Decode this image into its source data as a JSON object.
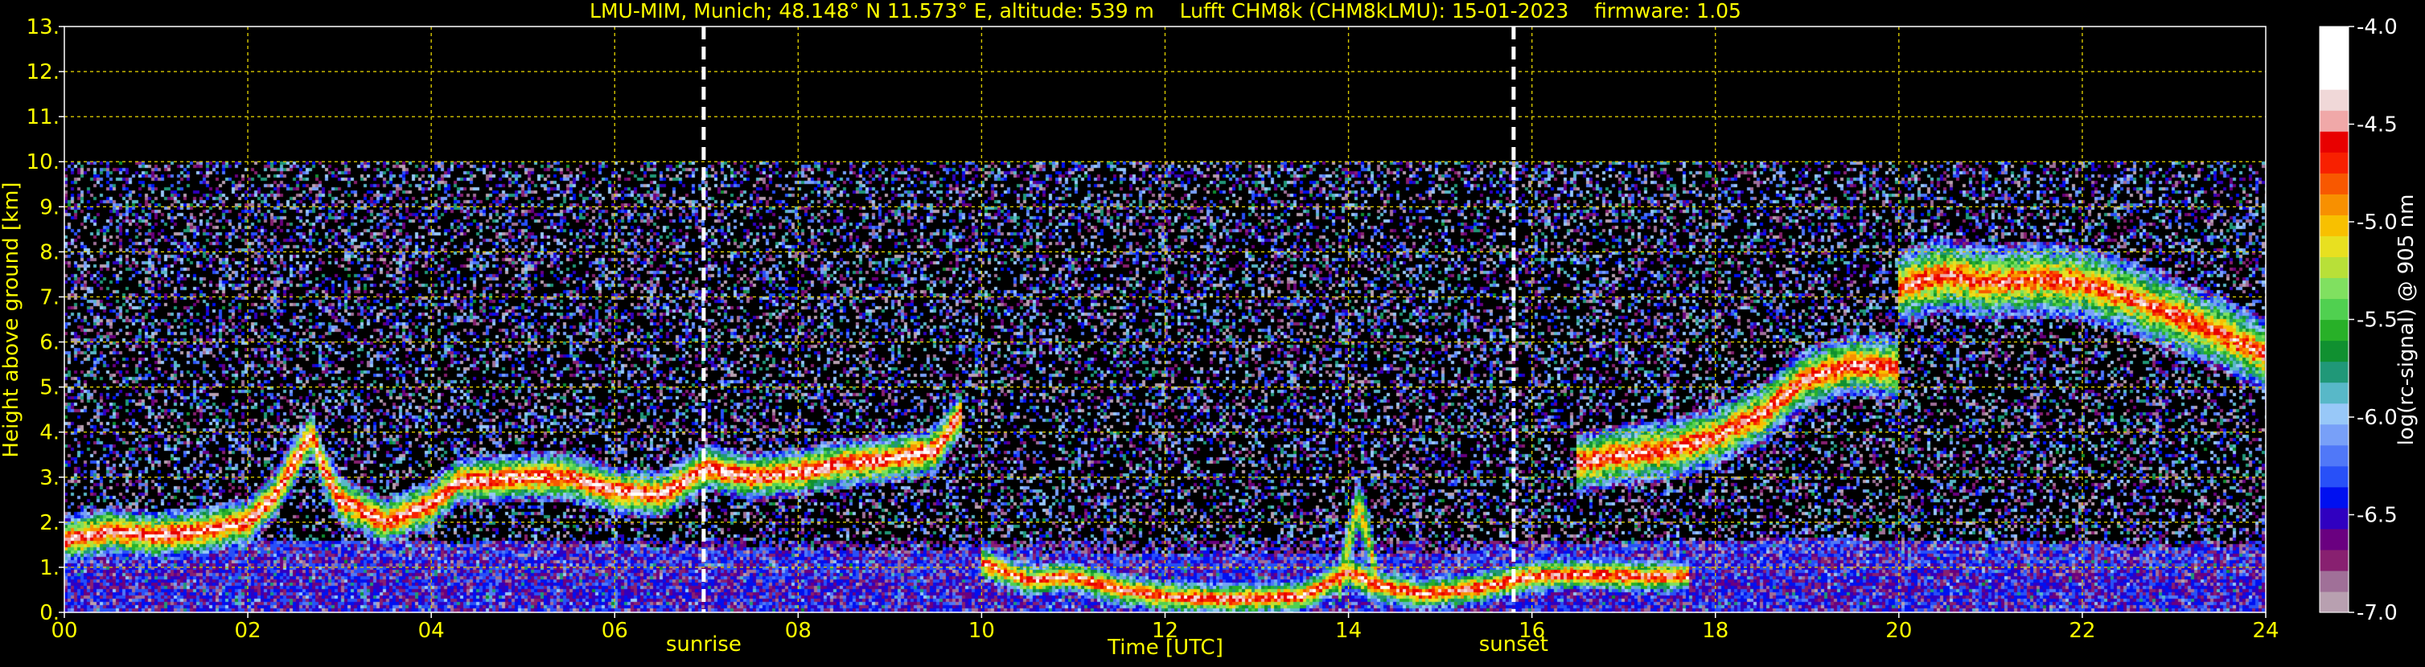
{
  "chart_data": {
    "type": "heatmap",
    "title": "LMU-MIM, Munich; 48.148° N 11.573° E, altitude: 539 m    Lufft CHM8k (CHM8kLMU): 15-01-2023    firmware: 1.05",
    "xlabel": "Time [UTC]",
    "ylabel": "Height above ground [km]",
    "xlim": [
      0,
      24
    ],
    "ylim": [
      0,
      13
    ],
    "x_ticks": [
      0,
      2,
      4,
      6,
      8,
      10,
      12,
      14,
      16,
      18,
      20,
      22,
      24
    ],
    "x_tick_labels": [
      "00",
      "02",
      "04",
      "06",
      "08",
      "10",
      "12",
      "14",
      "16",
      "18",
      "20",
      "22",
      "24"
    ],
    "y_ticks": [
      0,
      1,
      2,
      3,
      4,
      5,
      6,
      7,
      8,
      9,
      10,
      11,
      12,
      13
    ],
    "y_tick_labels": [
      "0.",
      "1.",
      "2.",
      "3.",
      "4.",
      "5.",
      "6.",
      "7.",
      "8.",
      "9.",
      "10.",
      "11.",
      "12.",
      "13."
    ],
    "grid": true,
    "data_top_km": 10,
    "markers": [
      {
        "label": "sunrise",
        "time": 6.97
      },
      {
        "label": "sunset",
        "time": 15.8
      }
    ],
    "colorbar": {
      "label": "log(rc-signal) @ 905 nm",
      "range": [
        -7.0,
        -4.0
      ],
      "tick_values": [
        -4.0,
        -4.5,
        -5.0,
        -5.5,
        -6.0,
        -6.5,
        -7.0
      ],
      "tick_labels": [
        "-4.0",
        "-4.5",
        "-5.0",
        "-5.5",
        "-6.0",
        "-6.5",
        "-7.0"
      ],
      "colors": [
        "#b8a0b0",
        "#a07098",
        "#882070",
        "#6a0080",
        "#3000c0",
        "#0010f0",
        "#2850f8",
        "#5078f8",
        "#78a0f8",
        "#98c8f8",
        "#58b8c8",
        "#209878",
        "#109030",
        "#28b028",
        "#50d050",
        "#80e060",
        "#b8e038",
        "#e8e020",
        "#f8c000",
        "#f89000",
        "#f85800",
        "#f82000",
        "#e80000",
        "#f0a8a8",
        "#f0d8d8",
        "#ffffff",
        "#ffffff",
        "#ffffff"
      ]
    },
    "layers": [
      {
        "name": "surface aerosol layer",
        "points": [
          [
            0,
            0.55
          ],
          [
            0.5,
            0.6
          ],
          [
            1,
            0.6
          ],
          [
            2,
            0.55
          ],
          [
            3,
            0.6
          ],
          [
            4,
            0.55
          ],
          [
            5,
            0.5
          ],
          [
            6,
            0.5
          ],
          [
            7,
            0.45
          ],
          [
            8,
            0.4
          ],
          [
            9,
            0.35
          ],
          [
            10,
            0.35
          ],
          [
            11,
            0.3
          ],
          [
            12,
            0.3
          ],
          [
            13,
            0.3
          ],
          [
            14,
            0.3
          ],
          [
            15,
            0.3
          ],
          [
            16,
            0.5
          ],
          [
            17,
            0.55
          ],
          [
            18,
            0.6
          ],
          [
            19,
            0.65
          ],
          [
            20,
            0.6
          ],
          [
            21,
            0.55
          ],
          [
            22,
            0.5
          ],
          [
            23,
            0.45
          ],
          [
            24,
            0.45
          ]
        ],
        "thickness": 1.0,
        "value": -6.6
      },
      {
        "name": "morning boundary layer",
        "points": [
          [
            0,
            1.6
          ],
          [
            0.5,
            1.8
          ],
          [
            1,
            1.7
          ],
          [
            1.5,
            1.8
          ],
          [
            2,
            2.0
          ],
          [
            2.3,
            2.6
          ],
          [
            2.5,
            3.3
          ],
          [
            2.7,
            4.0
          ],
          [
            2.8,
            3.3
          ],
          [
            3,
            2.5
          ],
          [
            3.5,
            2.0
          ],
          [
            4,
            2.4
          ],
          [
            4.3,
            2.9
          ],
          [
            5,
            3.0
          ],
          [
            5.5,
            3.0
          ],
          [
            6,
            2.7
          ],
          [
            6.5,
            2.6
          ],
          [
            7,
            3.2
          ],
          [
            7.5,
            3.0
          ],
          [
            8,
            3.1
          ],
          [
            8.5,
            3.3
          ],
          [
            9,
            3.4
          ],
          [
            9.5,
            3.6
          ],
          [
            9.8,
            4.5
          ]
        ],
        "thickness": 0.55,
        "value": -4.3
      },
      {
        "name": "near-surface layer",
        "points": [
          [
            10,
            1.1
          ],
          [
            10.5,
            0.7
          ],
          [
            11,
            0.8
          ],
          [
            11.5,
            0.5
          ],
          [
            12,
            0.35
          ],
          [
            12.5,
            0.3
          ],
          [
            13,
            0.3
          ],
          [
            13.5,
            0.35
          ],
          [
            14,
            0.9
          ],
          [
            14.3,
            0.6
          ],
          [
            14.8,
            0.4
          ],
          [
            15.3,
            0.5
          ],
          [
            15.8,
            0.7
          ],
          [
            16,
            0.8
          ],
          [
            16.5,
            0.85
          ],
          [
            17,
            0.8
          ],
          [
            17.7,
            0.8
          ]
        ],
        "thickness": 0.4,
        "value": -4.4
      },
      {
        "name": "convective plume",
        "points": [
          [
            13.9,
            0.6
          ],
          [
            14.0,
            1.5
          ],
          [
            14.1,
            2.4
          ],
          [
            14.2,
            1.8
          ],
          [
            14.3,
            0.8
          ]
        ],
        "thickness": 0.7,
        "value": -4.9
      },
      {
        "name": "evening ascending layer",
        "points": [
          [
            16.5,
            3.3
          ],
          [
            17,
            3.5
          ],
          [
            17.5,
            3.6
          ],
          [
            18,
            3.9
          ],
          [
            18.5,
            4.4
          ],
          [
            19,
            5.2
          ],
          [
            19.5,
            5.5
          ],
          [
            20,
            5.4
          ]
        ],
        "thickness": 0.7,
        "value": -4.4
      },
      {
        "name": "upper cloud layer",
        "points": [
          [
            20,
            7.2
          ],
          [
            20.5,
            7.5
          ],
          [
            21,
            7.3
          ],
          [
            21.5,
            7.4
          ],
          [
            22,
            7.3
          ],
          [
            22.5,
            7.0
          ],
          [
            23,
            6.6
          ],
          [
            23.5,
            6.2
          ],
          [
            24,
            5.7
          ]
        ],
        "thickness": 0.85,
        "value": -4.5
      }
    ]
  }
}
